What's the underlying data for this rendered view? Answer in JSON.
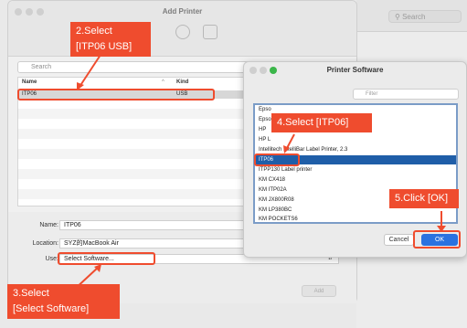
{
  "bg_window": {
    "search_placeholder": "Search"
  },
  "add_printer": {
    "title": "Add Printer",
    "search_placeholder": "Search",
    "columns": {
      "name": "Name",
      "sort_indicator": "^",
      "kind": "Kind"
    },
    "printer_row": {
      "name": "ITP06",
      "kind": "USB"
    },
    "form": {
      "name_label": "Name:",
      "name_value": "ITP06",
      "location_label": "Location:",
      "location_value": "SYZ的MacBook Air",
      "use_label": "Use:",
      "use_value": "Select Software...",
      "add_button": "Add"
    }
  },
  "software_dialog": {
    "title": "Printer Software",
    "filter_placeholder": "Filter",
    "items": [
      "Epso",
      "Epso",
      "HP",
      "HP L",
      "Intellitech IntelliBar Label Printer, 2.3",
      "ITP06",
      "ITPP130 Label printer",
      "KM CX418",
      "KM ITP02A",
      "KM JX800R08",
      "KM LP380BC",
      "KM POCKETS6"
    ],
    "selected_index": 5,
    "cancel_button": "Cancel",
    "ok_button": "OK"
  },
  "annotations": {
    "step2": "2.Select\n[ITP06 USB]",
    "step3": "3.Select\n[Select Software]",
    "step4": "4.Select [ITP06]",
    "step5": "5.Click [OK]"
  },
  "colors": {
    "annotation": "#ef4c2e",
    "ok_button": "#2a72e0",
    "selection": "#1f5ea8"
  }
}
